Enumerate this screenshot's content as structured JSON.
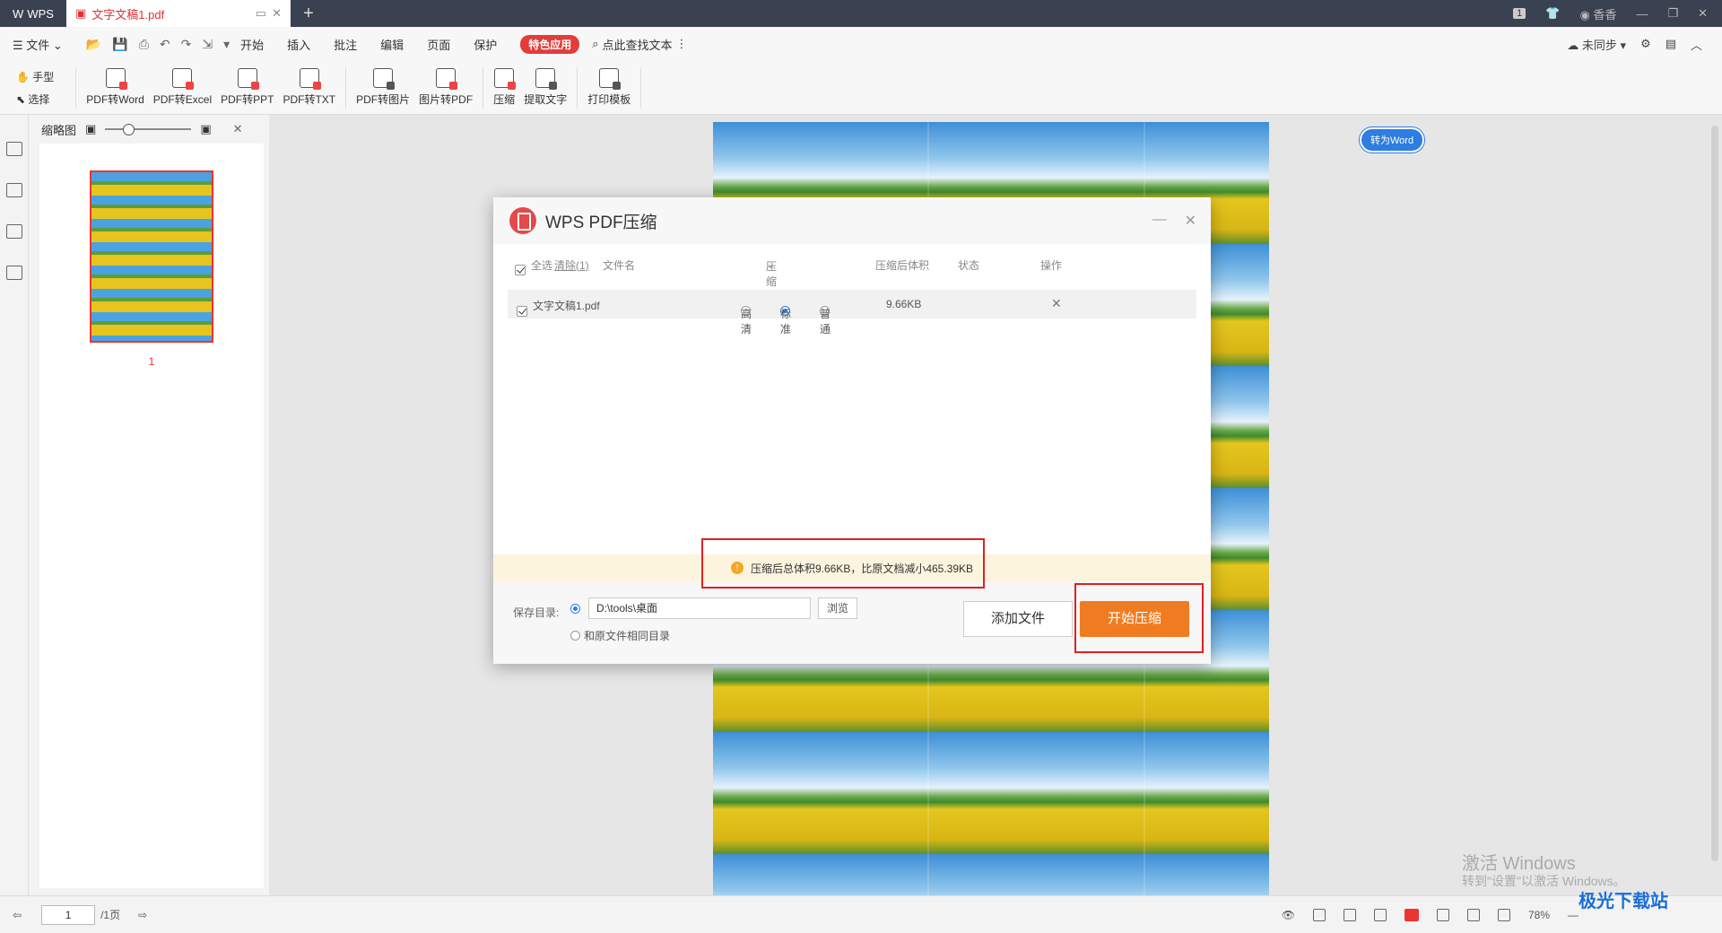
{
  "titlebar": {
    "app_label": "WPS",
    "doc_tab": "文字文稿1.pdf",
    "user": "香香",
    "page_badge": "1"
  },
  "menubar": {
    "file": "文件",
    "tabs": [
      "开始",
      "插入",
      "批注",
      "编辑",
      "页面",
      "保护"
    ],
    "special": "特色应用",
    "search": "点此查找文本",
    "sync": "未同步"
  },
  "ribbon": {
    "hand": "手型",
    "select": "选择",
    "tools": [
      "PDF转Word",
      "PDF转Excel",
      "PDF转PPT",
      "PDF转TXT",
      "PDF转图片",
      "图片转PDF",
      "压缩",
      "提取文字",
      "打印模板"
    ]
  },
  "thumbs": {
    "title": "缩略图",
    "page_num": "1"
  },
  "to_word": "转为Word",
  "dialog": {
    "title": "WPS PDF压缩",
    "columns": {
      "select_all": "全选",
      "clear": "清除(1)",
      "filename": "文件名",
      "level": "压缩程度",
      "size_after": "压缩后体积",
      "status": "状态",
      "action": "操作"
    },
    "file": {
      "name": "文字文稿1.pdf",
      "opt_hd": "高清",
      "opt_std": "标准",
      "opt_normal": "普通",
      "size": "9.66KB"
    },
    "notice": "压缩后总体积9.66KB，比原文档减小465.39KB",
    "save_label": "保存目录:",
    "save_path": "D:\\tools\\桌面",
    "browse": "浏览",
    "same_dir": "和原文件相同目录",
    "add_file": "添加文件",
    "start": "开始压缩"
  },
  "statusbar": {
    "page": "1",
    "total": "/1页",
    "zoom": "78%"
  },
  "watermark": {
    "line1": "激活 Windows",
    "line2": "转到\"设置\"以激活 Windows。",
    "site": "极光下载站"
  }
}
